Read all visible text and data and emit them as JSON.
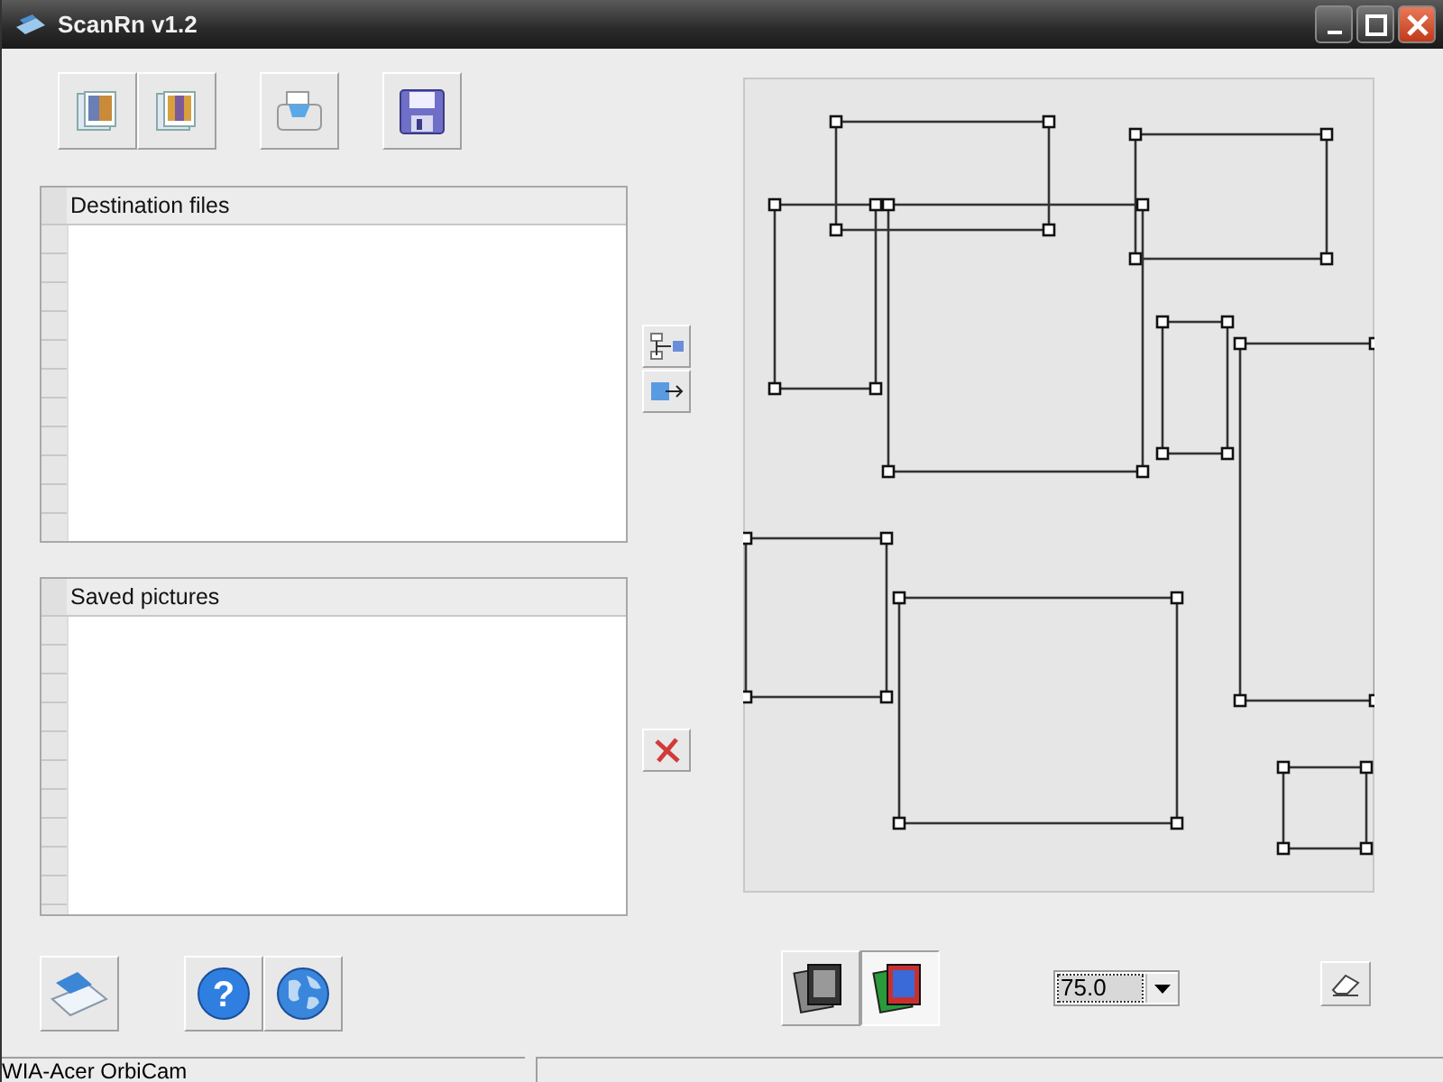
{
  "window": {
    "title": "ScanRn v1.2"
  },
  "lists": [
    {
      "header": "Destination files"
    },
    {
      "header": "Saved pictures"
    }
  ],
  "color_modes": [
    {
      "kind": "grayscale",
      "selected": false
    },
    {
      "kind": "color",
      "selected": true
    }
  ],
  "help_button": {
    "glyph": "?"
  },
  "zoom": {
    "value": "75.0"
  },
  "status_bar": {
    "device": "WIA-Acer OrbiCam"
  }
}
